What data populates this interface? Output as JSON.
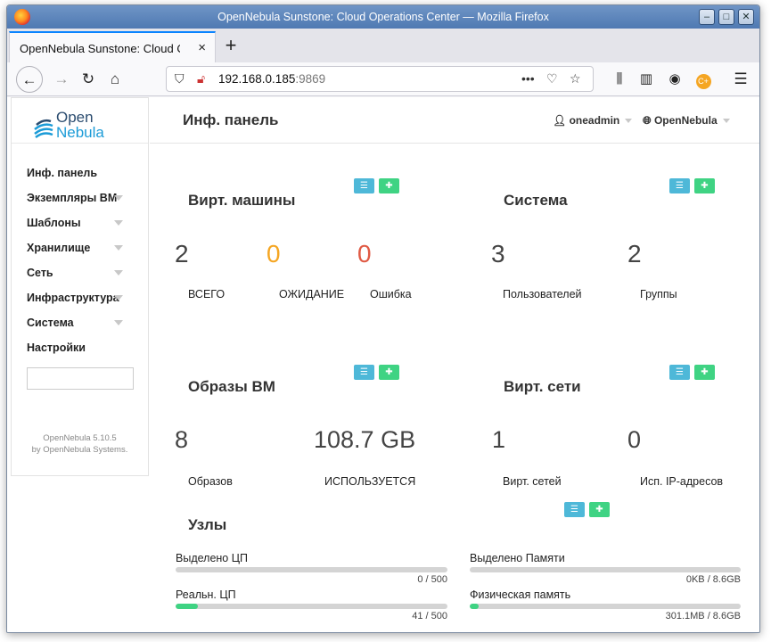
{
  "window": {
    "title": "OpenNebula Sunstone: Cloud Operations Center — Mozilla Firefox"
  },
  "tab": {
    "title": "OpenNebula Sunstone: Cloud O",
    "close": "×",
    "new_tab": "+"
  },
  "address": {
    "host": "192.168.0.185",
    "port": ":9869"
  },
  "app": {
    "logo_open": "Open",
    "logo_nebula": "Nebula",
    "page_title": "Инф. панель",
    "user": "oneadmin",
    "zone": "OpenNebula",
    "version": "OpenNebula 5.10.5",
    "by": "by OpenNebula Systems."
  },
  "sidebar": {
    "items": [
      {
        "label": "Инф. панель"
      },
      {
        "label": "Экземпляры ВМ"
      },
      {
        "label": "Шаблоны"
      },
      {
        "label": "Хранилище"
      },
      {
        "label": "Сеть"
      },
      {
        "label": "Инфраструктура"
      },
      {
        "label": "Система"
      },
      {
        "label": "Настройки"
      }
    ],
    "search_value": ""
  },
  "vms": {
    "title": "Вирт. машины",
    "total": "2",
    "total_label": "ВСЕГО",
    "pending": "0",
    "pending_label": "ОЖИДАНИЕ",
    "failed": "0",
    "failed_label": "Ошибка"
  },
  "system": {
    "title": "Система",
    "users": "3",
    "users_label": "Пользователей",
    "groups": "2",
    "groups_label": "Группы"
  },
  "images": {
    "title": "Образы ВМ",
    "count": "8",
    "count_label": "Образов",
    "used": "108.7 GB",
    "used_label": "ИСПОЛЬЗУЕТСЯ"
  },
  "vnets": {
    "title": "Вирт. сети",
    "count": "1",
    "count_label": "Вирт. сетей",
    "ips": "0",
    "ips_label": "Исп. IP-адресов"
  },
  "hosts": {
    "title": "Узлы",
    "alloc_cpu_label": "Выделено ЦП",
    "alloc_cpu_value": "0 / 500",
    "alloc_cpu_fraction": 0.0,
    "real_cpu_label": "Реальн. ЦП",
    "real_cpu_value": "41 / 500",
    "real_cpu_fraction": 0.082,
    "alloc_mem_label": "Выделено Памяти",
    "alloc_mem_value": "0KB / 8.6GB",
    "alloc_mem_fraction": 0.0,
    "phys_mem_label": "Физическая память",
    "phys_mem_value": "301.1MB / 8.6GB",
    "phys_mem_fraction": 0.034
  },
  "colors": {
    "accent_blue": "#4eb8d8",
    "accent_green": "#3fd383",
    "pending": "#f5a623",
    "failed": "#e05a44"
  }
}
